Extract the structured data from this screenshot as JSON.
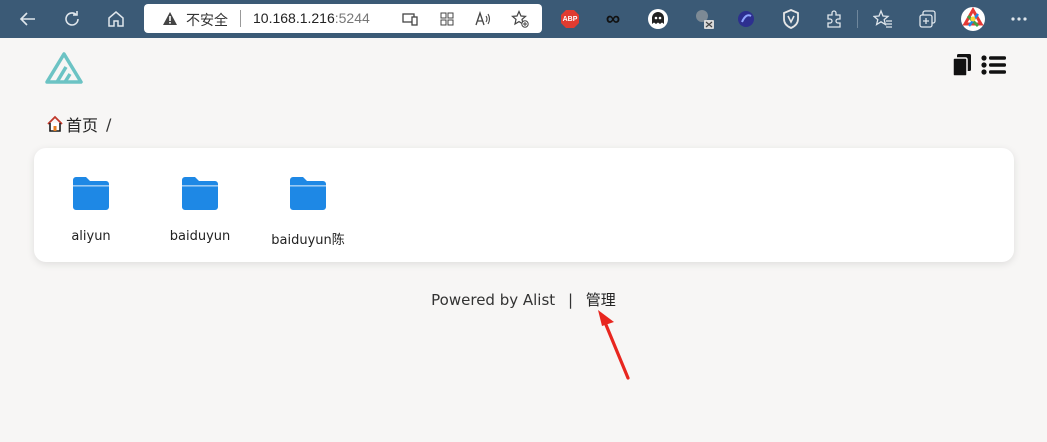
{
  "browser": {
    "address": {
      "security_label": "不安全",
      "host": "10.168.1.216",
      "port": ":5244"
    },
    "extensions": {
      "abp_label": "ABP",
      "infinity_label": "∞"
    }
  },
  "page": {
    "breadcrumb": {
      "home_label": "首页",
      "separator": "/"
    },
    "folders": [
      {
        "name": "aliyun"
      },
      {
        "name": "baiduyun"
      },
      {
        "name": "baiduyun陈"
      }
    ],
    "footer": {
      "powered_by": "Powered by Alist",
      "separator": "|",
      "manage_label": "管理"
    }
  },
  "colors": {
    "toolbar": "#3b5a76",
    "folder": "#1e88e5",
    "logo": "#6cc3c4",
    "arrow": "#e8261f",
    "page_bg": "#f7f6f5"
  },
  "icons": [
    "back-arrow-icon",
    "refresh-icon",
    "home-icon",
    "warning-icon",
    "app-available-icon",
    "grid-icon",
    "read-aloud-icon",
    "add-favorite-icon",
    "abp-icon",
    "infinity-icon",
    "ghost-icon",
    "tampermonkey-icon",
    "sphere-icon",
    "shield-icon",
    "extensions-puzzle-icon",
    "favorites-icon",
    "collections-icon",
    "profile-avatar-icon",
    "more-menu-icon",
    "copy-icon",
    "list-view-icon",
    "folder-icon"
  ]
}
